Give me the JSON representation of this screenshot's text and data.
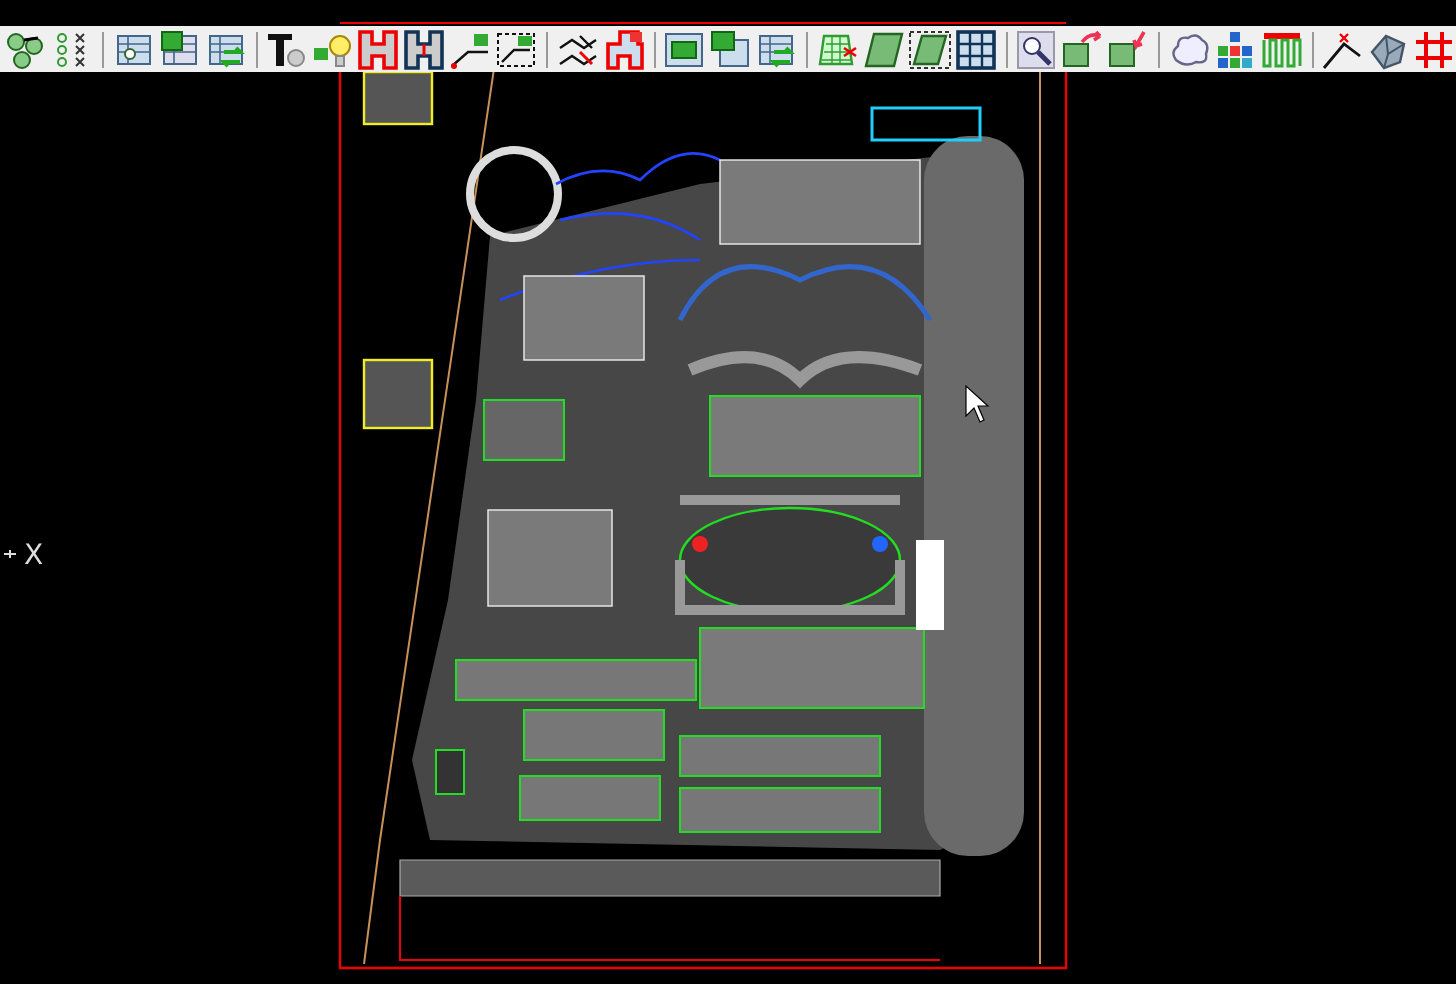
{
  "toolbar": {
    "groups": [
      {
        "buttons": [
          {
            "kind": "circles"
          },
          {
            "kind": "dots"
          }
        ]
      },
      {
        "buttons": [
          {
            "kind": "table-gear"
          },
          {
            "kind": "table-green"
          },
          {
            "kind": "table-arrows"
          }
        ]
      },
      {
        "buttons": [
          {
            "kind": "text-style"
          },
          {
            "kind": "bulb"
          },
          {
            "kind": "h-red"
          },
          {
            "kind": "h-blue"
          },
          {
            "kind": "area-line"
          },
          {
            "kind": "area-box"
          }
        ]
      },
      {
        "buttons": [
          {
            "kind": "cross-lines"
          },
          {
            "kind": "house-red"
          }
        ]
      },
      {
        "buttons": [
          {
            "kind": "table-area"
          },
          {
            "kind": "table-area-green"
          },
          {
            "kind": "table-arrows"
          }
        ]
      },
      {
        "buttons": [
          {
            "kind": "hatch"
          },
          {
            "kind": "plate"
          },
          {
            "kind": "plate-dashed"
          },
          {
            "kind": "blue-grid"
          }
        ]
      },
      {
        "buttons": [
          {
            "kind": "magnifier"
          },
          {
            "kind": "box-arrow-up"
          },
          {
            "kind": "box-arrow-down"
          }
        ]
      },
      {
        "buttons": [
          {
            "kind": "cloud"
          },
          {
            "kind": "blocks"
          },
          {
            "kind": "wave"
          }
        ]
      },
      {
        "buttons": [
          {
            "kind": "angle-line"
          },
          {
            "kind": "solid"
          },
          {
            "kind": "red-grid"
          }
        ]
      }
    ]
  },
  "canvas": {
    "drawing": {
      "kind": "site-plan"
    },
    "axis_label": "X"
  }
}
